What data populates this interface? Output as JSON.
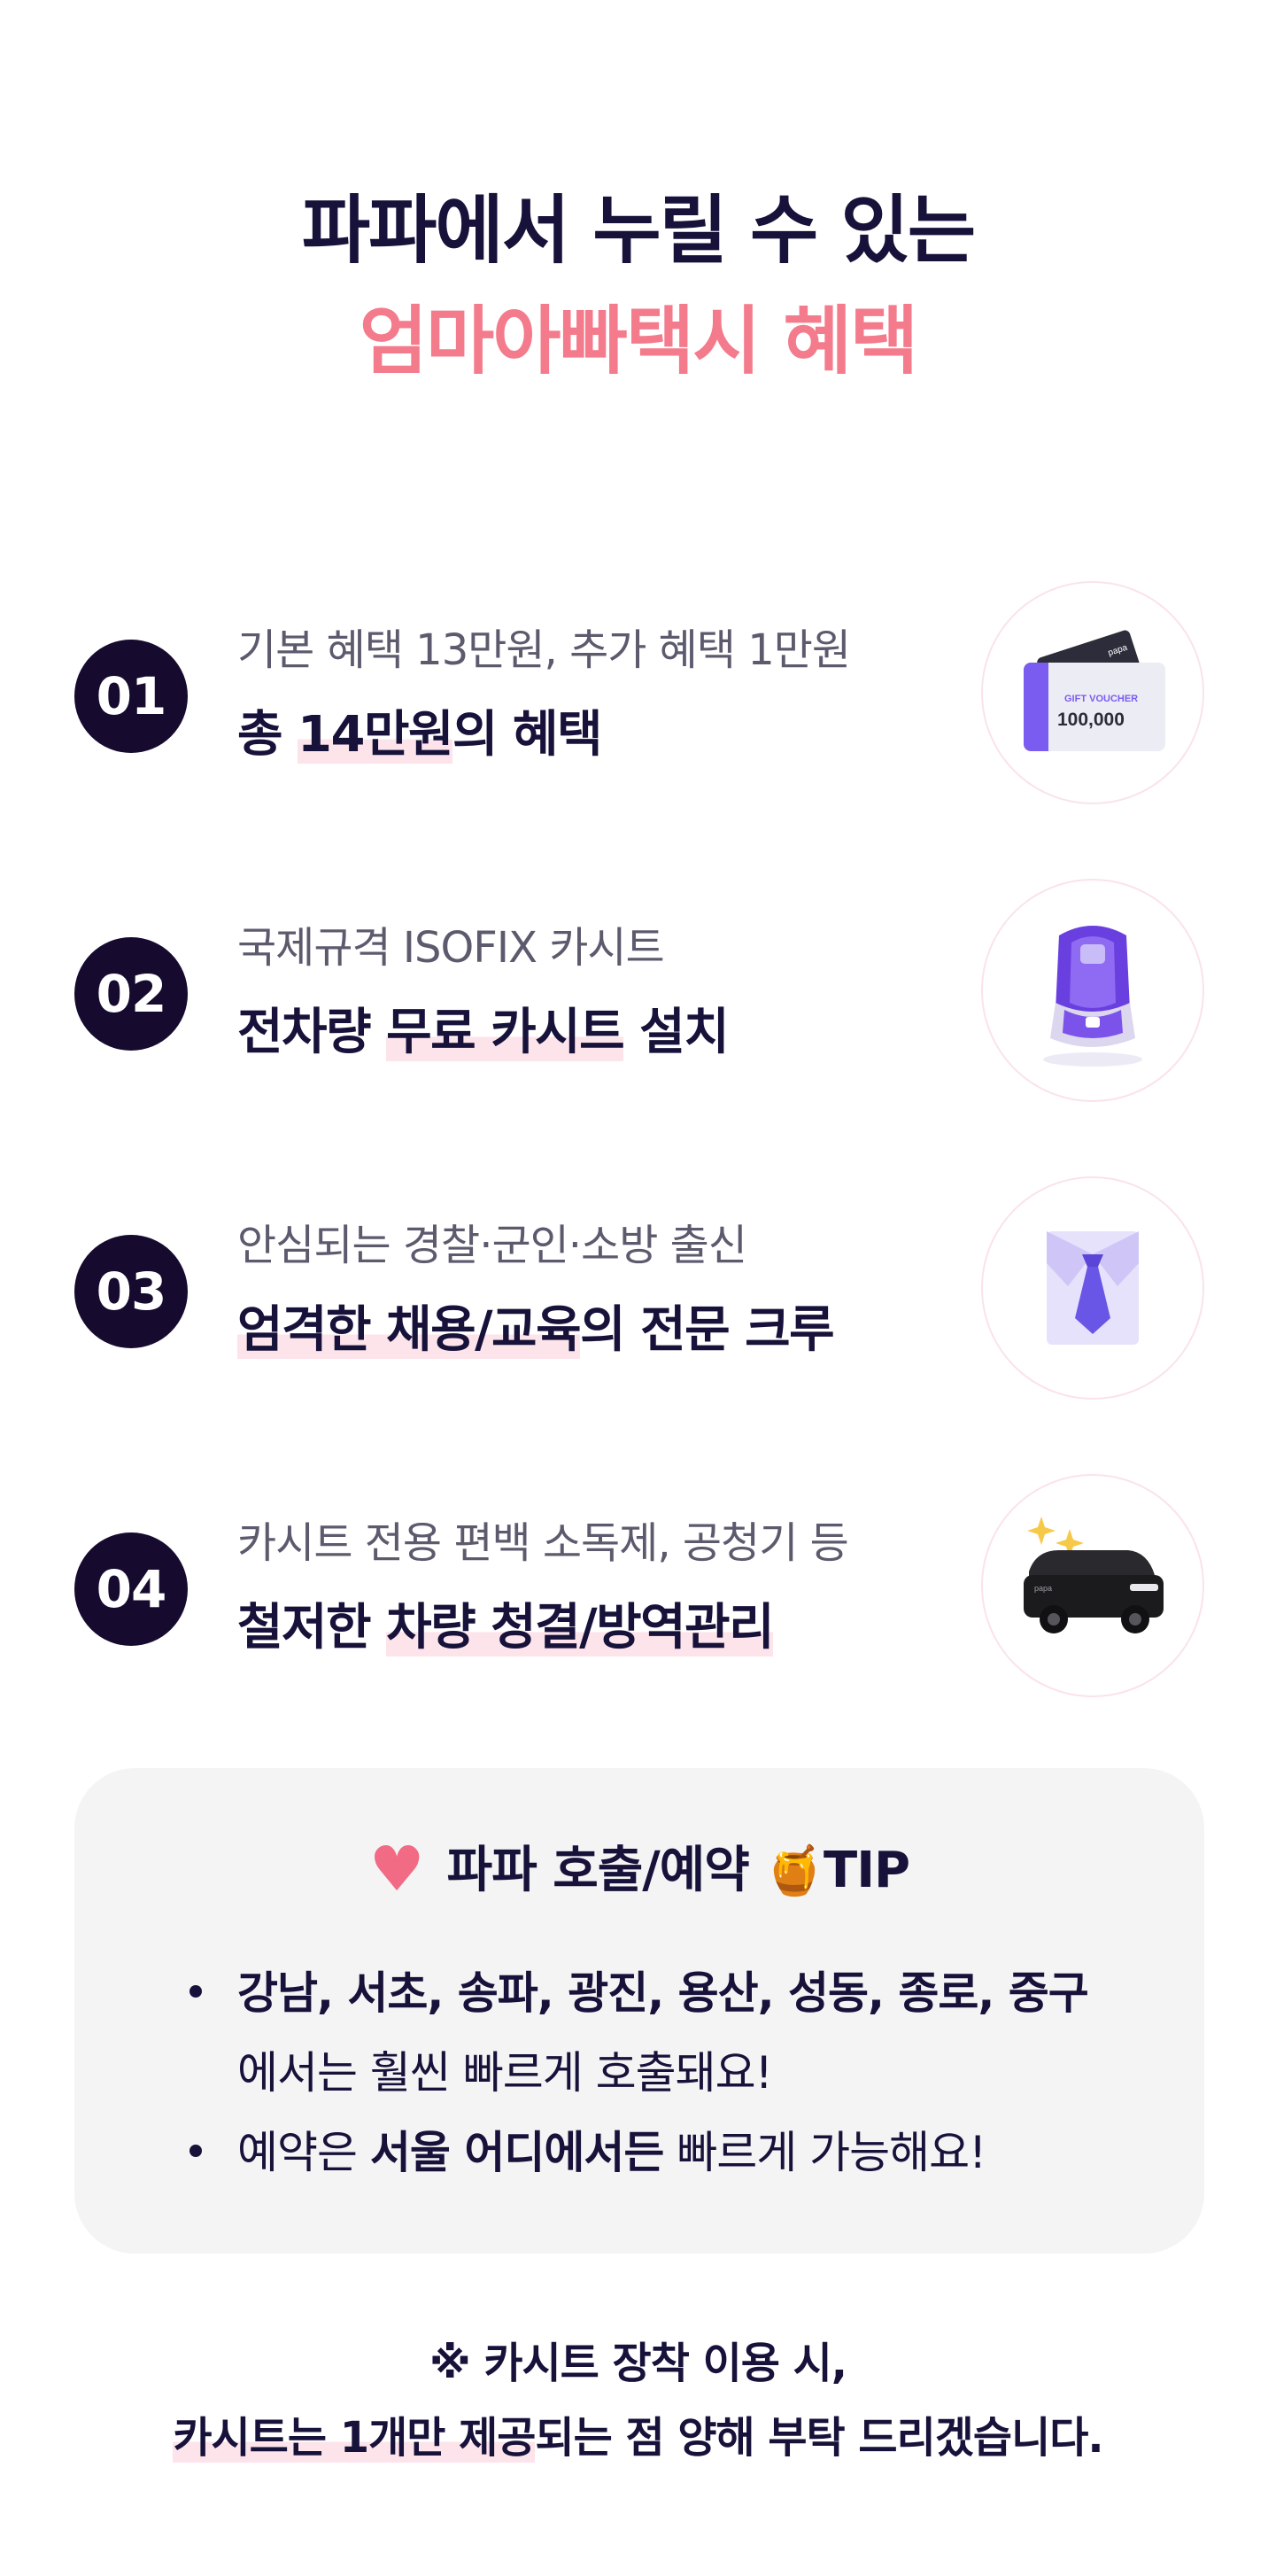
{
  "header": {
    "line1": "파파에서 누릴 수 있는",
    "line2": "엄마아빠택시 혜택",
    "accent_color": "#f37b8c"
  },
  "benefits": [
    {
      "number": "01",
      "subtitle": "기본 혜택 13만원, 추가 혜택 1만원",
      "title_pre": "총 ",
      "title_hl": "14만원",
      "title_post": "의 혜택",
      "image": "gift-voucher",
      "voucher_label": "GIFT VOUCHER",
      "voucher_amount": "100,000",
      "voucher_brand": "papa"
    },
    {
      "number": "02",
      "subtitle": "국제규격 ISOFIX 카시트",
      "title_pre": "전차량 ",
      "title_hl": "무료 카시트",
      "title_post": " 설치",
      "image": "car-seat"
    },
    {
      "number": "03",
      "subtitle": "안심되는 경찰·군인·소방 출신",
      "title_pre": "",
      "title_hl": "엄격한 채용/교육",
      "title_post": "의 전문 크루",
      "image": "shirt-tie"
    },
    {
      "number": "04",
      "subtitle": "카시트 전용 편백 소독제, 공청기 등",
      "title_pre": "철저한 ",
      "title_hl": "차량 청결/방역관리",
      "title_post": "",
      "image": "clean-car",
      "car_brand": "papa"
    }
  ],
  "tip": {
    "title": "파파 호출/예약",
    "honey": "🍯",
    "tip_label": "TIP",
    "items": [
      {
        "bold": "강남, 서초, 송파, 광진, 용산, 성동, 종로, 중구",
        "rest": ""
      },
      {
        "bold": "",
        "rest": "에서는 훨씬 빠르게 호출돼요!"
      },
      {
        "bold_pre": "예약은 ",
        "bold": "서울 어디에서든",
        "rest": " 빠르게 가능해요!"
      }
    ]
  },
  "notice": {
    "line1": "※ 카시트 장착 이용 시,",
    "line2_hl": "카시트는 1개만 제공",
    "line2_rest": "되는 점 양해 부탁 드리겠습니다."
  }
}
